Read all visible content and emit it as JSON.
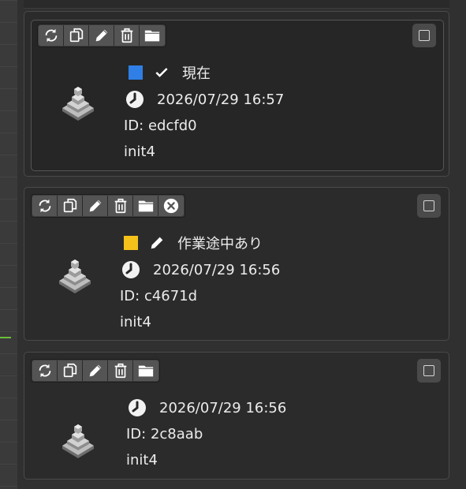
{
  "colors": {
    "status_current": "#2f7fe6",
    "status_wip": "#f5c21b"
  },
  "toolbar_icons": [
    "refresh-icon",
    "duplicate-icon",
    "edit-icon",
    "trash-icon",
    "folder-icon",
    "close-circle-icon"
  ],
  "cards": [
    {
      "status_label": "現在",
      "timestamp": "2026/07/29 16:57",
      "id_text": "ID: edcfd0",
      "name": "init4"
    },
    {
      "status_label": "作業途中あり",
      "timestamp": "2026/07/29 16:56",
      "id_text": "ID: c4671d",
      "name": "init4"
    },
    {
      "timestamp": "2026/07/29 16:56",
      "id_text": "ID: 2c8aab",
      "name": "init4"
    }
  ]
}
